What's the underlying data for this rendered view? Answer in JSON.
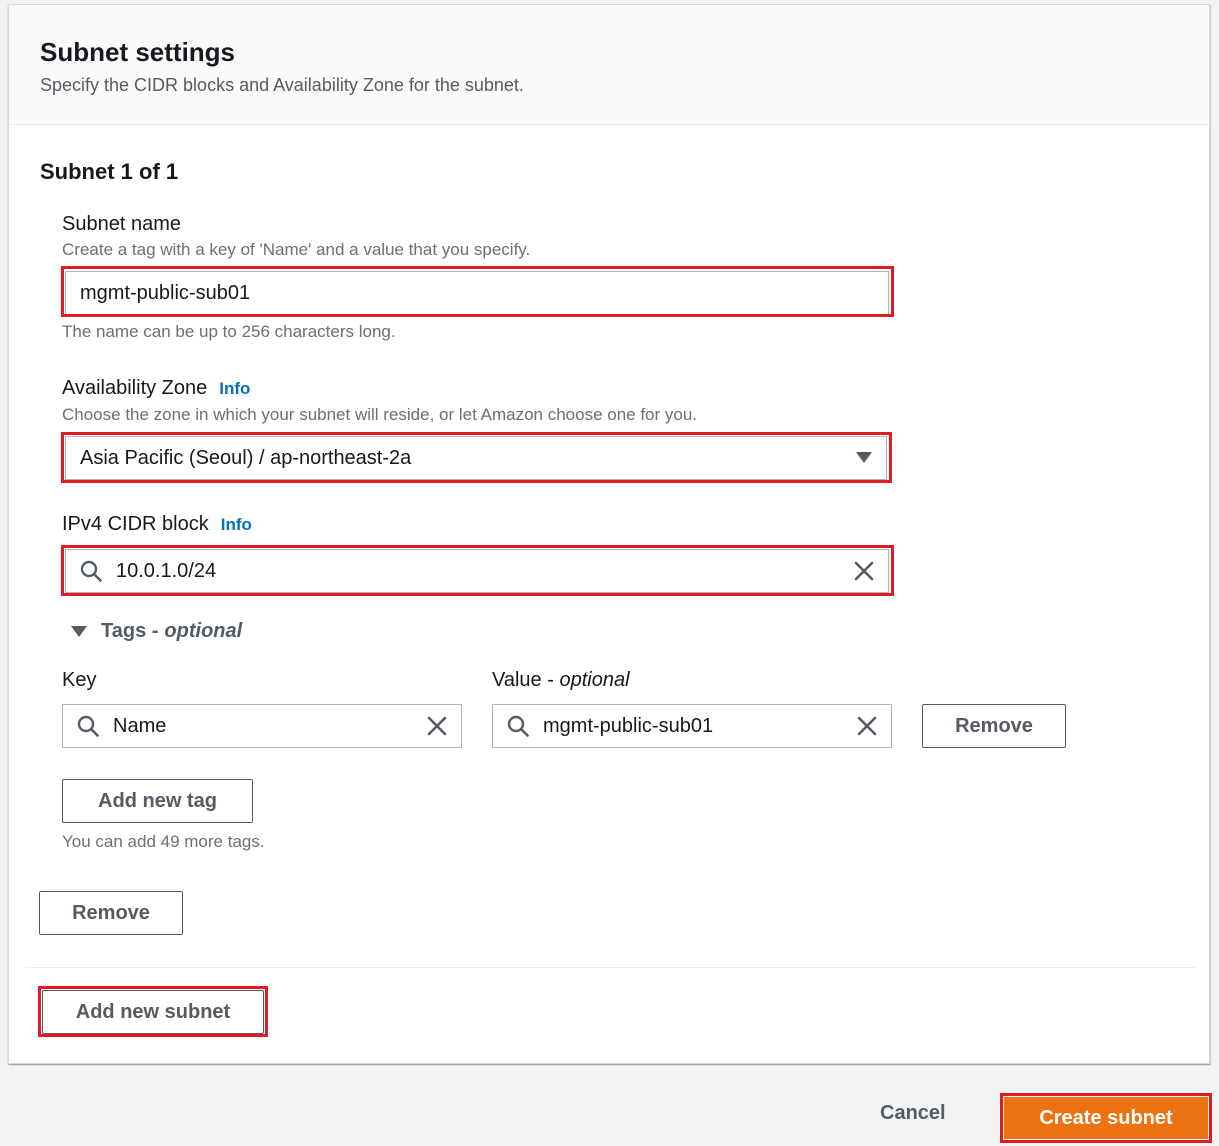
{
  "panel": {
    "title": "Subnet settings",
    "description": "Specify the CIDR blocks and Availability Zone for the subnet."
  },
  "subnet": {
    "heading": "Subnet 1 of 1",
    "name": {
      "label": "Subnet name",
      "description": "Create a tag with a key of 'Name' and a value that you specify.",
      "value": "mgmt-public-sub01",
      "constraint": "The name can be up to 256 characters long."
    },
    "az": {
      "label": "Availability Zone",
      "info": "Info",
      "description": "Choose the zone in which your subnet will reside, or let Amazon choose one for you.",
      "value": "Asia Pacific (Seoul) / ap-northeast-2a"
    },
    "cidr": {
      "label": "IPv4 CIDR block",
      "info": "Info",
      "value": "10.0.1.0/24"
    },
    "tags": {
      "toggle_label": "Tags -",
      "toggle_optional": "optional",
      "key_label": "Key",
      "value_label": "Value -",
      "value_optional": "optional",
      "rows": [
        {
          "key": "Name",
          "value": "mgmt-public-sub01",
          "remove": "Remove"
        }
      ],
      "add_button": "Add new tag",
      "remaining": "You can add 49 more tags."
    },
    "remove_button": "Remove"
  },
  "add_subnet_button": "Add new subnet",
  "footer": {
    "cancel": "Cancel",
    "create": "Create subnet"
  },
  "colors": {
    "highlight": "#e01b24",
    "primary": "#ec7211",
    "link": "#0073bb"
  }
}
